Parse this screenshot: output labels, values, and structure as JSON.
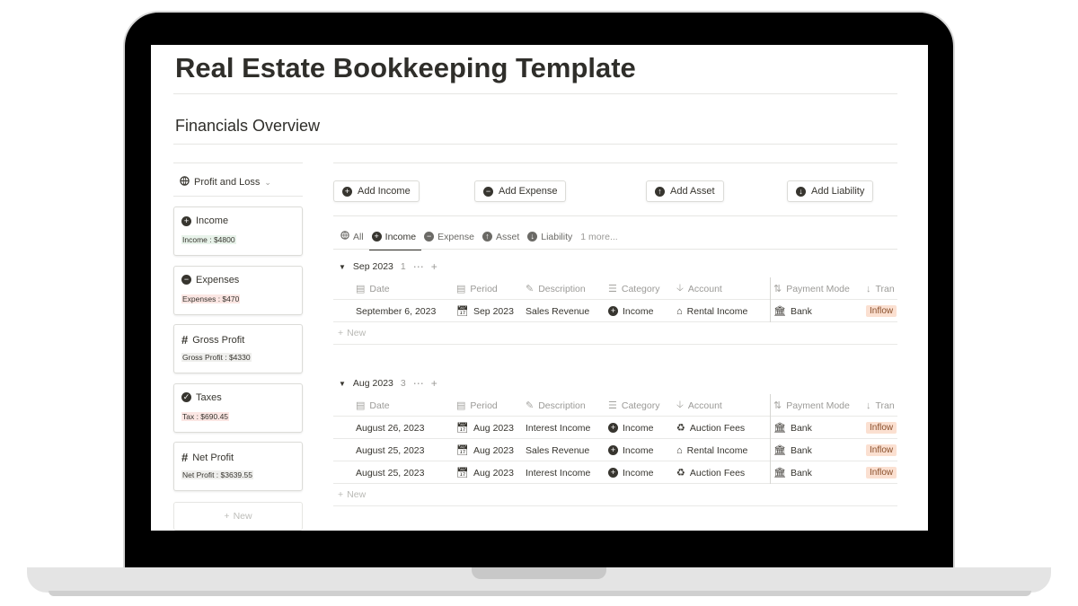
{
  "page": {
    "title": "Real Estate Bookkeeping Template",
    "section_title": "Financials Overview"
  },
  "sidebar": {
    "view_label": "Profit and Loss",
    "view_icon": "globe-icon",
    "cards": [
      {
        "title": "Income",
        "value": "Income : $4800",
        "icon": "plus-circle-icon"
      },
      {
        "title": "Expenses",
        "value": "Expenses : $470",
        "icon": "minus-circle-icon"
      },
      {
        "title": "Gross Profit",
        "value": "Gross Profit : $4330",
        "icon": "hash-icon"
      },
      {
        "title": "Taxes",
        "value": "Tax : $690.45",
        "icon": "check-circle-icon"
      },
      {
        "title": "Net Profit",
        "value": "Net Profit : $3639.55",
        "icon": "hash-icon"
      }
    ],
    "new_label": "New"
  },
  "actions": {
    "add_income": "Add Income",
    "add_expense": "Add Expense",
    "add_asset": "Add Asset",
    "add_liability": "Add Liability"
  },
  "tabs": [
    {
      "label": "All",
      "icon": "globe-icon"
    },
    {
      "label": "Income",
      "icon": "plus-circle-icon",
      "active": true
    },
    {
      "label": "Expense",
      "icon": "minus-circle-icon"
    },
    {
      "label": "Asset",
      "icon": "up-circle-icon"
    },
    {
      "label": "Liability",
      "icon": "down-circle-icon"
    },
    {
      "label": "1 more..."
    }
  ],
  "columns": {
    "date": "Date",
    "period": "Period",
    "description": "Description",
    "category": "Category",
    "account": "Account",
    "payment_mode": "Payment Mode",
    "transaction": "Tran"
  },
  "groups": [
    {
      "label": "Sep 2023",
      "count": "1",
      "rows": [
        {
          "date": "September 6, 2023",
          "period": "Sep 2023",
          "description": "Sales Revenue",
          "category": "Income",
          "account": "Rental Income",
          "account_icon": "house-icon",
          "payment_mode": "Bank",
          "transaction": "Inflow"
        }
      ]
    },
    {
      "label": "Aug 2023",
      "count": "3",
      "rows": [
        {
          "date": "August 26, 2023",
          "period": "Aug 2023",
          "description": "Interest Income",
          "category": "Income",
          "account": "Auction Fees",
          "account_icon": "network-icon",
          "payment_mode": "Bank",
          "transaction": "Inflow"
        },
        {
          "date": "August 25, 2023",
          "period": "Aug 2023",
          "description": "Sales Revenue",
          "category": "Income",
          "account": "Rental Income",
          "account_icon": "house-icon",
          "payment_mode": "Bank",
          "transaction": "Inflow"
        },
        {
          "date": "August 25, 2023",
          "period": "Aug 2023",
          "description": "Interest Income",
          "category": "Income",
          "account": "Auction Fees",
          "account_icon": "network-icon",
          "payment_mode": "Bank",
          "transaction": "Inflow"
        }
      ]
    }
  ],
  "new_row_label": "New",
  "colors": {
    "text": "#37352f",
    "muted": "#9b9a97",
    "inflow_bg": "#fbe0d1",
    "income_value_bg": "#e8f3ea",
    "expense_value_bg": "#fbe6e3"
  }
}
